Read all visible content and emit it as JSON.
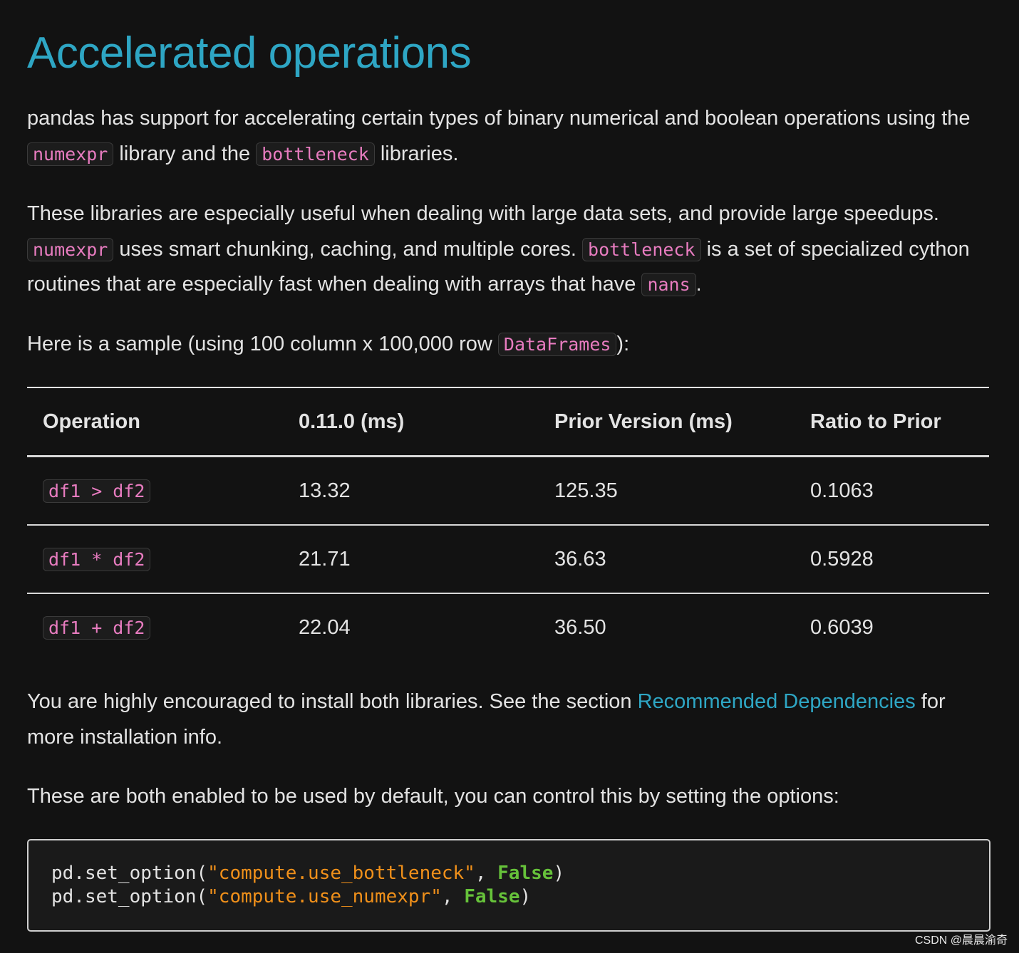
{
  "heading": "Accelerated operations",
  "intro": {
    "t1": "pandas has support for accelerating certain types of binary numerical and boolean operations using the ",
    "c1": "numexpr",
    "t2": " library and the ",
    "c2": "bottleneck",
    "t3": " libraries."
  },
  "para2": {
    "t1": "These libraries are especially useful when dealing with large data sets, and provide large speedups. ",
    "c1": "numexpr",
    "t2": " uses smart chunking, caching, and multiple cores. ",
    "c2": "bottleneck",
    "t3": " is a set of specialized cython routines that are especially fast when dealing with arrays that have ",
    "c3": "nans",
    "t4": "."
  },
  "para3": {
    "t1": "Here is a sample (using 100 column x 100,000 row ",
    "c1": "DataFrames",
    "t2": "):"
  },
  "table": {
    "headers": [
      "Operation",
      "0.11.0 (ms)",
      "Prior Version (ms)",
      "Ratio to Prior"
    ],
    "rows": [
      {
        "op": "df1 > df2",
        "v011": "13.32",
        "prior": "125.35",
        "ratio": "0.1063"
      },
      {
        "op": "df1 * df2",
        "v011": "21.71",
        "prior": "36.63",
        "ratio": "0.5928"
      },
      {
        "op": "df1 + df2",
        "v011": "22.04",
        "prior": "36.50",
        "ratio": "0.6039"
      }
    ]
  },
  "para4": {
    "t1": "You are highly encouraged to install both libraries. See the section ",
    "link": "Recommended Dependencies",
    "t2": " for more installation info."
  },
  "para5": "These are both enabled to be used by default, you can control this by setting the options:",
  "code": {
    "line1": {
      "pre": "pd.set_option(",
      "str": "\"compute.use_bottleneck\"",
      "mid": ", ",
      "kw": "False",
      "post": ")"
    },
    "line2": {
      "pre": "pd.set_option(",
      "str": "\"compute.use_numexpr\"",
      "mid": ", ",
      "kw": "False",
      "post": ")"
    }
  },
  "footer": "CSDN @晨晨渝奇"
}
